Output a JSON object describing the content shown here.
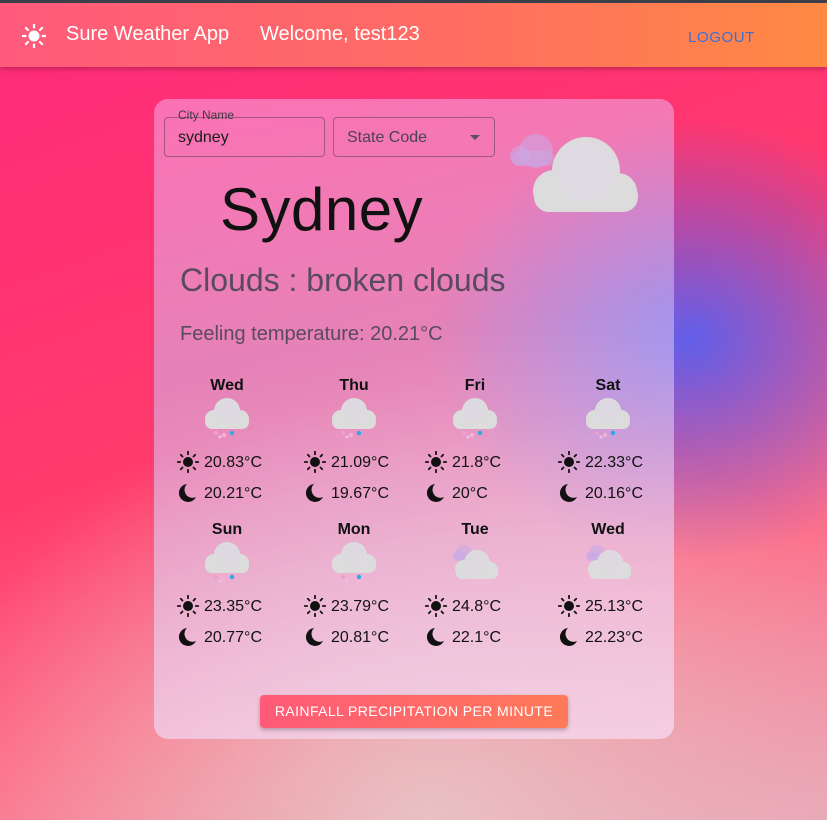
{
  "header": {
    "app_title": "Sure Weather App",
    "welcome": "Welcome, test123",
    "logout_label": "LOGOUT",
    "logo_icon": "sun-icon"
  },
  "search": {
    "city_label": "City Name",
    "city_value": "sydney",
    "state_placeholder": "State Code"
  },
  "current": {
    "city": "Sydney",
    "condition": "Clouds : broken clouds",
    "feeling": "Feeling temperature: 20.21°C",
    "icon": "broken-clouds-icon"
  },
  "forecast": [
    {
      "day": "Wed",
      "high": "20.83°C",
      "low": "20.21°C",
      "icon": "rain-icon"
    },
    {
      "day": "Thu",
      "high": "21.09°C",
      "low": "19.67°C",
      "icon": "rain-icon"
    },
    {
      "day": "Fri",
      "high": "21.8°C",
      "low": "20°C",
      "icon": "rain-icon"
    },
    {
      "day": "Sat",
      "high": "22.33°C",
      "low": "20.16°C",
      "icon": "rain-icon"
    },
    {
      "day": "Sun",
      "high": "23.35°C",
      "low": "20.77°C",
      "icon": "rain-icon"
    },
    {
      "day": "Mon",
      "high": "23.79°C",
      "low": "20.81°C",
      "icon": "rain-icon"
    },
    {
      "day": "Tue",
      "high": "24.8°C",
      "low": "22.1°C",
      "icon": "broken-clouds-icon"
    },
    {
      "day": "Wed",
      "high": "25.13°C",
      "low": "22.23°C",
      "icon": "broken-clouds-icon"
    }
  ],
  "actions": {
    "rain_button": "RAINFALL PRECIPITATION PER MINUTE"
  }
}
